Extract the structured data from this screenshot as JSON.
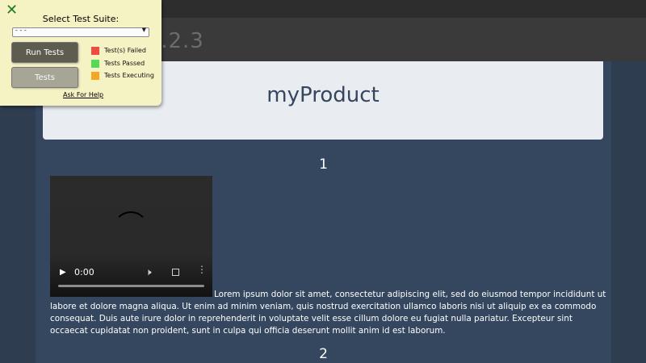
{
  "navbar": {
    "brand": "myProduct 1.2.3"
  },
  "jumbotron": {
    "title": "myProduct"
  },
  "sections": [
    {
      "number": "1"
    },
    {
      "number": "2"
    }
  ],
  "video": {
    "time": "0:00",
    "progress": 0
  },
  "article": {
    "text": "Lorem ipsum dolor sit amet, consectetur adipiscing elit, sed do eiusmod tempor incididunt ut labore et dolore magna aliqua. Ut enim ad minim veniam, quis nostrud exercitation ullamco laboris nisi ut aliquip ex ea commodo consequat. Duis aute irure dolor in reprehenderit in voluptate velit esse cillum dolore eu fugiat nulla pariatur. Excepteur sint occaecat cupidatat non proident, sunt in culpa qui officia deserunt mollit anim id est laborum."
  },
  "test_panel": {
    "close_icon": "close-icon",
    "title": "Select Test Suite:",
    "select": {
      "selected": "- - -"
    },
    "run_label": "Run Tests",
    "tests_label": "Tests",
    "legend": [
      {
        "label": "Test(s) Failed",
        "color": "#ef4b3f"
      },
      {
        "label": "Tests Passed",
        "color": "#57d957"
      },
      {
        "label": "Tests Executing",
        "color": "#f5a623"
      }
    ],
    "help_label": "Ask For Help"
  },
  "colors": {
    "page_bg": "#2f3d51",
    "content_bg": "#34475f",
    "panel_bg": "#f5f2c4"
  }
}
